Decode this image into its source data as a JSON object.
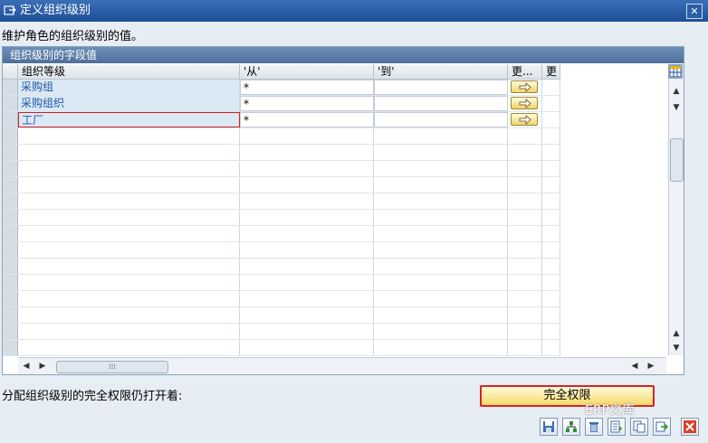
{
  "window": {
    "title": "定义组织级别",
    "close_glyph": "✕"
  },
  "description": "维护角色的组织级别的值。",
  "panel": {
    "title": "组织级别的字段值"
  },
  "table": {
    "columns": [
      "组织等级",
      "'从'",
      "'到'",
      "更...",
      "更"
    ],
    "rows": [
      {
        "org_level": "采购组",
        "from": "*",
        "to": ""
      },
      {
        "org_level": "采购组织",
        "from": "*",
        "to": ""
      },
      {
        "org_level": "工厂",
        "from": "*",
        "to": ""
      }
    ],
    "empty_row_count": 14
  },
  "scroll": {
    "up": "▲",
    "down": "▼",
    "left": "◀",
    "right": "▶",
    "grip": "⁞⁞⁞"
  },
  "footer": {
    "label": "分配组织级别的完全权限仍打开着:",
    "full_auth_button": "完全权限"
  },
  "watermark": "ERP文库",
  "toolbar_icons": [
    "save-icon",
    "org-icon",
    "delete-icon",
    "list-icon",
    "copy-icon",
    "copy2-icon",
    "cancel-icon"
  ],
  "colors": {
    "title_bar": "#1f4f96",
    "panel_header": "#4d6f99",
    "button_highlight": "#d8232a",
    "link_text": "#1d56a6"
  }
}
